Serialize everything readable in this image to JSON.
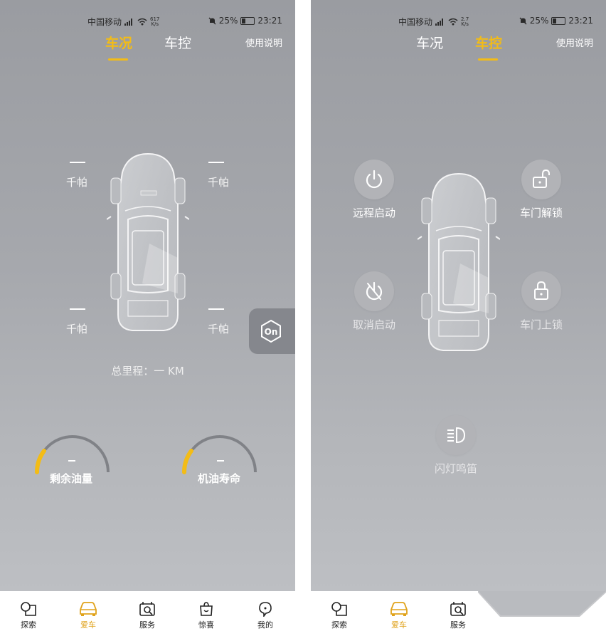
{
  "status_bar": {
    "carrier": "中国移动",
    "speed_left": "617",
    "speed_unit": "K/s",
    "speed_right": "2.7",
    "battery": "25%",
    "time": "23:21"
  },
  "tabs": [
    "车况",
    "车控"
  ],
  "help_label": "使用说明",
  "condition": {
    "tire_dash": "—",
    "tire_unit": "千帕",
    "mileage": "总里程：一 KM",
    "gauges": [
      {
        "label": "剩余油量",
        "value": "—",
        "level": 0.12
      },
      {
        "label": "机油寿命",
        "value": "—",
        "level": 0.12
      }
    ],
    "on_badge": "On"
  },
  "control": {
    "remote_start": "远程启动",
    "cancel_start": "取消启动",
    "unlock": "车门解锁",
    "lock": "车门上锁",
    "flash_horn": "闪灯鸣笛"
  },
  "nav_left": [
    {
      "label": "探索",
      "icon": "explore-icon"
    },
    {
      "label": "爱车",
      "icon": "car-icon"
    },
    {
      "label": "服务",
      "icon": "service-icon"
    },
    {
      "label": "惊喜",
      "icon": "gift-bag-icon"
    },
    {
      "label": "我的",
      "icon": "profile-icon"
    }
  ],
  "nav_right": [
    {
      "label": "探索",
      "icon": "explore-icon"
    },
    {
      "label": "爱车",
      "icon": "car-icon"
    },
    {
      "label": "服务",
      "icon": "service-icon"
    }
  ],
  "colors": {
    "accent": "#f3bc16",
    "screen_bg": "#a6a8ad"
  }
}
